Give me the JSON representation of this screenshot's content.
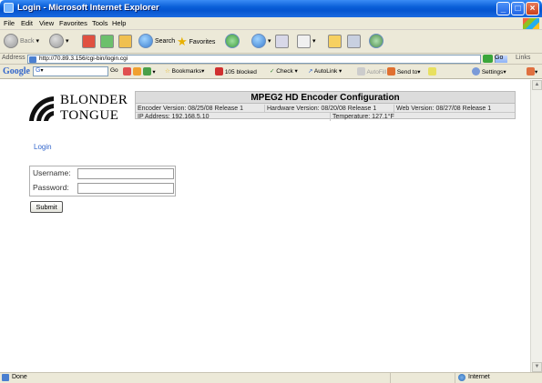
{
  "window": {
    "title": "Login - Microsoft Internet Explorer"
  },
  "menu": {
    "items": [
      "File",
      "Edit",
      "View",
      "Favorites",
      "Tools",
      "Help"
    ]
  },
  "toolbar": {
    "back": "Back",
    "search": "Search",
    "favorites": "Favorites"
  },
  "address": {
    "label": "Address",
    "url": "http://70.89.3.156/cgi-bin/login.cgi",
    "go": "Go",
    "links": "Links"
  },
  "google_bar": {
    "logo": "Google",
    "logo_suffix": "G",
    "go": "Go",
    "bookmarks": "Bookmarks",
    "blocked": "105 blocked",
    "check": "Check",
    "autolink": "AutoLink",
    "autofill": "AutoFill",
    "sendto": "Send to",
    "settings": "Settings"
  },
  "page": {
    "brand_line1": "BLONDER",
    "brand_line2": "TONGUE",
    "header_title": "MPEG2 HD Encoder Configuration",
    "encoder_version": "Encoder Version: 08/25/08 Release 1",
    "hardware_version": "Hardware Version: 08/20/08 Release 1",
    "web_version": "Web Version: 08/27/08 Release 1",
    "ip_address": "IP Address: 192.168.5.10",
    "temperature": "Temperature: 127.1°F",
    "login_link": "Login",
    "username_label": "Username:",
    "password_label": "Password:",
    "submit_label": "Submit"
  },
  "status": {
    "left": "Done",
    "zone": "Internet"
  },
  "colors": {
    "titlebar": "#0555d0",
    "link": "#3366cc",
    "chrome": "#ece9d8"
  }
}
